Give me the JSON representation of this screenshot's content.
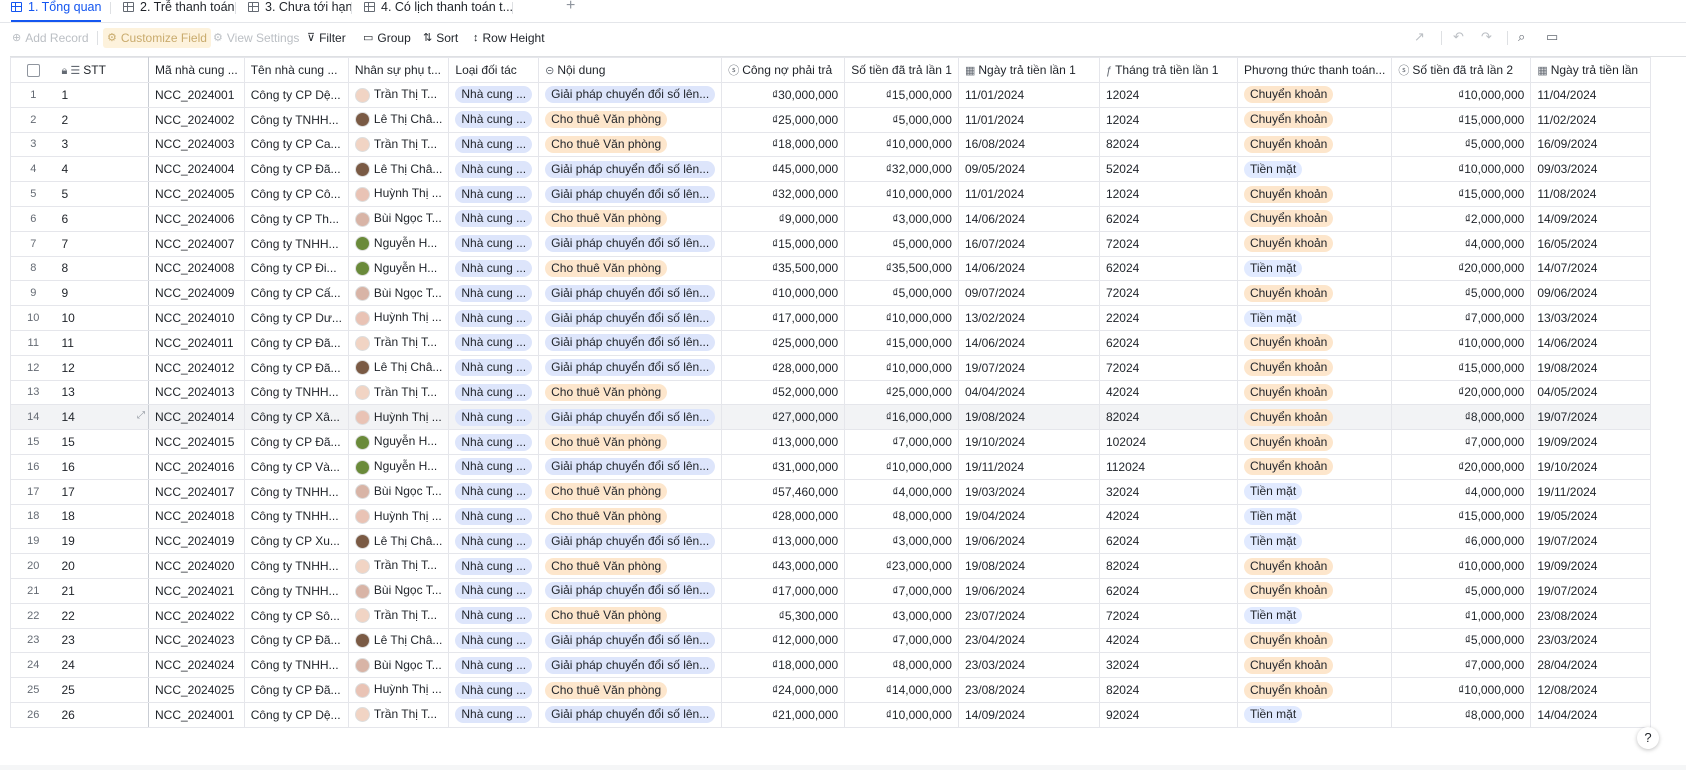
{
  "tabs": [
    {
      "label": "1. Tổng quan",
      "active": true
    },
    {
      "label": "2. Trễ thanh toán",
      "active": false
    },
    {
      "label": "3. Chưa tới hạn",
      "active": false
    },
    {
      "label": "4. Có lịch thanh toán t...",
      "active": false
    }
  ],
  "toolbar": {
    "add_record": "Add Record",
    "customize_field": "Customize Field",
    "view_settings": "View Settings",
    "filter": "Filter",
    "group": "Group",
    "sort": "Sort",
    "row_height": "Row Height"
  },
  "columns": [
    {
      "label": "STT",
      "icon": "list-number-icon"
    },
    {
      "label": "Mã nhà cung ...",
      "icon": ""
    },
    {
      "label": "Tên nhà cung ...",
      "icon": ""
    },
    {
      "label": "Nhân sự phụ t...",
      "icon": ""
    },
    {
      "label": "Loại đối tác",
      "icon": ""
    },
    {
      "label": "Nội dung",
      "icon": "single-select-icon"
    },
    {
      "label": "Công nợ phải trả",
      "icon": "currency-icon"
    },
    {
      "label": "Số tiền đã trả lần 1",
      "icon": ""
    },
    {
      "label": "Ngày trả tiền lần 1",
      "icon": "date-icon"
    },
    {
      "label": "Tháng trả tiền lần 1",
      "icon": "formula-icon"
    },
    {
      "label": "Phương thức thanh toán...",
      "icon": ""
    },
    {
      "label": "Số tiền đã trả lần 2",
      "icon": "currency-icon"
    },
    {
      "label": "Ngày trả tiền lần",
      "icon": "date-icon"
    }
  ],
  "colors": {
    "accent": "#1456f0",
    "tag_blue": "#dde5fb",
    "tag_orange": "#fde6cc"
  },
  "rows": [
    {
      "n": "1",
      "stt": "1",
      "ma": "NCC_2024001",
      "ten": "Công ty CP Dệ...",
      "ns": "Trần Thị T...",
      "loai": "Nhà cung ...",
      "nd": "Giải pháp chuyển đổi số lên...",
      "cn": "₫30,000,000",
      "st1": "₫15,000,000",
      "ng1": "11/01/2024",
      "th1": "12024",
      "pt": "Chuyển khoản",
      "st2": "₫10,000,000",
      "ng2": "11/04/2024"
    },
    {
      "n": "2",
      "stt": "2",
      "ma": "NCC_2024002",
      "ten": "Công ty TNHH...",
      "ns": "Lê Thị Châ...",
      "loai": "Nhà cung ...",
      "nd": "Cho thuê Văn phòng",
      "cn": "₫25,000,000",
      "st1": "₫5,000,000",
      "ng1": "11/01/2024",
      "th1": "12024",
      "pt": "Chuyển khoản",
      "st2": "₫15,000,000",
      "ng2": "11/02/2024"
    },
    {
      "n": "3",
      "stt": "3",
      "ma": "NCC_2024003",
      "ten": "Công ty CP Ca...",
      "ns": "Trần Thị T...",
      "loai": "Nhà cung ...",
      "nd": "Cho thuê Văn phòng",
      "cn": "₫18,000,000",
      "st1": "₫10,000,000",
      "ng1": "16/08/2024",
      "th1": "82024",
      "pt": "Chuyển khoản",
      "st2": "₫5,000,000",
      "ng2": "16/09/2024"
    },
    {
      "n": "4",
      "stt": "4",
      "ma": "NCC_2024004",
      "ten": "Công ty CP Đã...",
      "ns": "Lê Thị Châ...",
      "loai": "Nhà cung ...",
      "nd": "Giải pháp chuyển đổi số lên...",
      "cn": "₫45,000,000",
      "st1": "₫32,000,000",
      "ng1": "09/05/2024",
      "th1": "52024",
      "pt": "Tiền mặt",
      "st2": "₫10,000,000",
      "ng2": "09/03/2024"
    },
    {
      "n": "5",
      "stt": "5",
      "ma": "NCC_2024005",
      "ten": "Công ty CP Cô...",
      "ns": "Huỳnh Thị ...",
      "loai": "Nhà cung ...",
      "nd": "Giải pháp chuyển đổi số lên...",
      "cn": "₫32,000,000",
      "st1": "₫10,000,000",
      "ng1": "11/01/2024",
      "th1": "12024",
      "pt": "Chuyển khoản",
      "st2": "₫15,000,000",
      "ng2": "11/08/2024"
    },
    {
      "n": "6",
      "stt": "6",
      "ma": "NCC_2024006",
      "ten": "Công ty CP Th...",
      "ns": "Bùi Ngọc T...",
      "loai": "Nhà cung ...",
      "nd": "Cho thuê Văn phòng",
      "cn": "₫9,000,000",
      "st1": "₫3,000,000",
      "ng1": "14/06/2024",
      "th1": "62024",
      "pt": "Chuyển khoản",
      "st2": "₫2,000,000",
      "ng2": "14/09/2024"
    },
    {
      "n": "7",
      "stt": "7",
      "ma": "NCC_2024007",
      "ten": "Công ty TNHH...",
      "ns": "Nguyễn H...",
      "loai": "Nhà cung ...",
      "nd": "Giải pháp chuyển đổi số lên...",
      "cn": "₫15,000,000",
      "st1": "₫5,000,000",
      "ng1": "16/07/2024",
      "th1": "72024",
      "pt": "Chuyển khoản",
      "st2": "₫4,000,000",
      "ng2": "16/05/2024"
    },
    {
      "n": "8",
      "stt": "8",
      "ma": "NCC_2024008",
      "ten": "Công ty CP Đi...",
      "ns": "Nguyễn H...",
      "loai": "Nhà cung ...",
      "nd": "Cho thuê Văn phòng",
      "cn": "₫35,500,000",
      "st1": "₫35,500,000",
      "ng1": "14/06/2024",
      "th1": "62024",
      "pt": "Tiền mặt",
      "st2": "₫20,000,000",
      "ng2": "14/07/2024"
    },
    {
      "n": "9",
      "stt": "9",
      "ma": "NCC_2024009",
      "ten": "Công ty CP Cấ...",
      "ns": "Bùi Ngọc T...",
      "loai": "Nhà cung ...",
      "nd": "Giải pháp chuyển đổi số lên...",
      "cn": "₫10,000,000",
      "st1": "₫5,000,000",
      "ng1": "09/07/2024",
      "th1": "72024",
      "pt": "Chuyển khoản",
      "st2": "₫5,000,000",
      "ng2": "09/06/2024"
    },
    {
      "n": "10",
      "stt": "10",
      "ma": "NCC_2024010",
      "ten": "Công ty CP Dư...",
      "ns": "Huỳnh Thị ...",
      "loai": "Nhà cung ...",
      "nd": "Giải pháp chuyển đổi số lên...",
      "cn": "₫17,000,000",
      "st1": "₫10,000,000",
      "ng1": "13/02/2024",
      "th1": "22024",
      "pt": "Tiền mặt",
      "st2": "₫7,000,000",
      "ng2": "13/03/2024"
    },
    {
      "n": "11",
      "stt": "11",
      "ma": "NCC_2024011",
      "ten": "Công ty CP Đã...",
      "ns": "Trần Thị T...",
      "loai": "Nhà cung ...",
      "nd": "Giải pháp chuyển đổi số lên...",
      "cn": "₫25,000,000",
      "st1": "₫15,000,000",
      "ng1": "14/06/2024",
      "th1": "62024",
      "pt": "Chuyển khoản",
      "st2": "₫10,000,000",
      "ng2": "14/06/2024"
    },
    {
      "n": "12",
      "stt": "12",
      "ma": "NCC_2024012",
      "ten": "Công ty CP Đã...",
      "ns": "Lê Thị Châ...",
      "loai": "Nhà cung ...",
      "nd": "Giải pháp chuyển đổi số lên...",
      "cn": "₫28,000,000",
      "st1": "₫10,000,000",
      "ng1": "19/07/2024",
      "th1": "72024",
      "pt": "Chuyển khoản",
      "st2": "₫15,000,000",
      "ng2": "19/08/2024"
    },
    {
      "n": "13",
      "stt": "13",
      "ma": "NCC_2024013",
      "ten": "Công ty TNHH...",
      "ns": "Trần Thị T...",
      "loai": "Nhà cung ...",
      "nd": "Cho thuê Văn phòng",
      "cn": "₫52,000,000",
      "st1": "₫25,000,000",
      "ng1": "04/04/2024",
      "th1": "42024",
      "pt": "Chuyển khoản",
      "st2": "₫20,000,000",
      "ng2": "04/05/2024"
    },
    {
      "n": "14",
      "stt": "14",
      "ma": "NCC_2024014",
      "ten": "Công ty CP Xâ...",
      "ns": "Huỳnh Thị ...",
      "loai": "Nhà cung ...",
      "nd": "Giải pháp chuyển đổi số lên...",
      "cn": "₫27,000,000",
      "st1": "₫16,000,000",
      "ng1": "19/08/2024",
      "th1": "82024",
      "pt": "Chuyển khoản",
      "st2": "₫8,000,000",
      "ng2": "19/07/2024"
    },
    {
      "n": "15",
      "stt": "15",
      "ma": "NCC_2024015",
      "ten": "Công ty CP Đã...",
      "ns": "Nguyễn H...",
      "loai": "Nhà cung ...",
      "nd": "Cho thuê Văn phòng",
      "cn": "₫13,000,000",
      "st1": "₫7,000,000",
      "ng1": "19/10/2024",
      "th1": "102024",
      "pt": "Chuyển khoản",
      "st2": "₫7,000,000",
      "ng2": "19/09/2024"
    },
    {
      "n": "16",
      "stt": "16",
      "ma": "NCC_2024016",
      "ten": "Công ty CP Và...",
      "ns": "Nguyễn H...",
      "loai": "Nhà cung ...",
      "nd": "Giải pháp chuyển đổi số lên...",
      "cn": "₫31,000,000",
      "st1": "₫10,000,000",
      "ng1": "19/11/2024",
      "th1": "112024",
      "pt": "Chuyển khoản",
      "st2": "₫20,000,000",
      "ng2": "19/10/2024"
    },
    {
      "n": "17",
      "stt": "17",
      "ma": "NCC_2024017",
      "ten": "Công ty TNHH...",
      "ns": "Bùi Ngọc T...",
      "loai": "Nhà cung ...",
      "nd": "Cho thuê Văn phòng",
      "cn": "₫57,460,000",
      "st1": "₫4,000,000",
      "ng1": "19/03/2024",
      "th1": "32024",
      "pt": "Tiền mặt",
      "st2": "₫4,000,000",
      "ng2": "19/11/2024"
    },
    {
      "n": "18",
      "stt": "18",
      "ma": "NCC_2024018",
      "ten": "Công ty TNHH...",
      "ns": "Huỳnh Thị ...",
      "loai": "Nhà cung ...",
      "nd": "Cho thuê Văn phòng",
      "cn": "₫28,000,000",
      "st1": "₫8,000,000",
      "ng1": "19/04/2024",
      "th1": "42024",
      "pt": "Tiền mặt",
      "st2": "₫15,000,000",
      "ng2": "19/05/2024"
    },
    {
      "n": "19",
      "stt": "19",
      "ma": "NCC_2024019",
      "ten": "Công ty CP Xu...",
      "ns": "Lê Thị Châ...",
      "loai": "Nhà cung ...",
      "nd": "Giải pháp chuyển đổi số lên...",
      "cn": "₫13,000,000",
      "st1": "₫3,000,000",
      "ng1": "19/06/2024",
      "th1": "62024",
      "pt": "Tiền mặt",
      "st2": "₫6,000,000",
      "ng2": "19/07/2024"
    },
    {
      "n": "20",
      "stt": "20",
      "ma": "NCC_2024020",
      "ten": "Công ty TNHH...",
      "ns": "Trần Thị T...",
      "loai": "Nhà cung ...",
      "nd": "Cho thuê Văn phòng",
      "cn": "₫43,000,000",
      "st1": "₫23,000,000",
      "ng1": "19/08/2024",
      "th1": "82024",
      "pt": "Chuyển khoản",
      "st2": "₫10,000,000",
      "ng2": "19/09/2024"
    },
    {
      "n": "21",
      "stt": "21",
      "ma": "NCC_2024021",
      "ten": "Công ty TNHH...",
      "ns": "Bùi Ngọc T...",
      "loai": "Nhà cung ...",
      "nd": "Giải pháp chuyển đổi số lên...",
      "cn": "₫17,000,000",
      "st1": "₫7,000,000",
      "ng1": "19/06/2024",
      "th1": "62024",
      "pt": "Chuyển khoản",
      "st2": "₫5,000,000",
      "ng2": "19/07/2024"
    },
    {
      "n": "22",
      "stt": "22",
      "ma": "NCC_2024022",
      "ten": "Công ty CP Sô...",
      "ns": "Trần Thị T...",
      "loai": "Nhà cung ...",
      "nd": "Cho thuê Văn phòng",
      "cn": "₫5,300,000",
      "st1": "₫3,000,000",
      "ng1": "23/07/2024",
      "th1": "72024",
      "pt": "Tiền mặt",
      "st2": "₫1,000,000",
      "ng2": "23/08/2024"
    },
    {
      "n": "23",
      "stt": "23",
      "ma": "NCC_2024023",
      "ten": "Công ty CP Đã...",
      "ns": "Lê Thị Châ...",
      "loai": "Nhà cung ...",
      "nd": "Giải pháp chuyển đổi số lên...",
      "cn": "₫12,000,000",
      "st1": "₫7,000,000",
      "ng1": "23/04/2024",
      "th1": "42024",
      "pt": "Chuyển khoản",
      "st2": "₫5,000,000",
      "ng2": "23/03/2024"
    },
    {
      "n": "24",
      "stt": "24",
      "ma": "NCC_2024024",
      "ten": "Công ty TNHH...",
      "ns": "Bùi Ngọc T...",
      "loai": "Nhà cung ...",
      "nd": "Giải pháp chuyển đổi số lên...",
      "cn": "₫18,000,000",
      "st1": "₫8,000,000",
      "ng1": "23/03/2024",
      "th1": "32024",
      "pt": "Chuyển khoản",
      "st2": "₫7,000,000",
      "ng2": "28/04/2024"
    },
    {
      "n": "25",
      "stt": "25",
      "ma": "NCC_2024025",
      "ten": "Công ty CP Đã...",
      "ns": "Huỳnh Thị ...",
      "loai": "Nhà cung ...",
      "nd": "Cho thuê Văn phòng",
      "cn": "₫24,000,000",
      "st1": "₫14,000,000",
      "ng1": "23/08/2024",
      "th1": "82024",
      "pt": "Chuyển khoản",
      "st2": "₫10,000,000",
      "ng2": "12/08/2024"
    },
    {
      "n": "26",
      "stt": "26",
      "ma": "NCC_2024001",
      "ten": "Công ty CP Dệ...",
      "ns": "Trần Thị T...",
      "loai": "Nhà cung ...",
      "nd": "Giải pháp chuyển đổi số lên...",
      "cn": "₫21,000,000",
      "st1": "₫10,000,000",
      "ng1": "14/09/2024",
      "th1": "92024",
      "pt": "Tiền mặt",
      "st2": "₫8,000,000",
      "ng2": "14/04/2024"
    }
  ],
  "help_label": "?"
}
